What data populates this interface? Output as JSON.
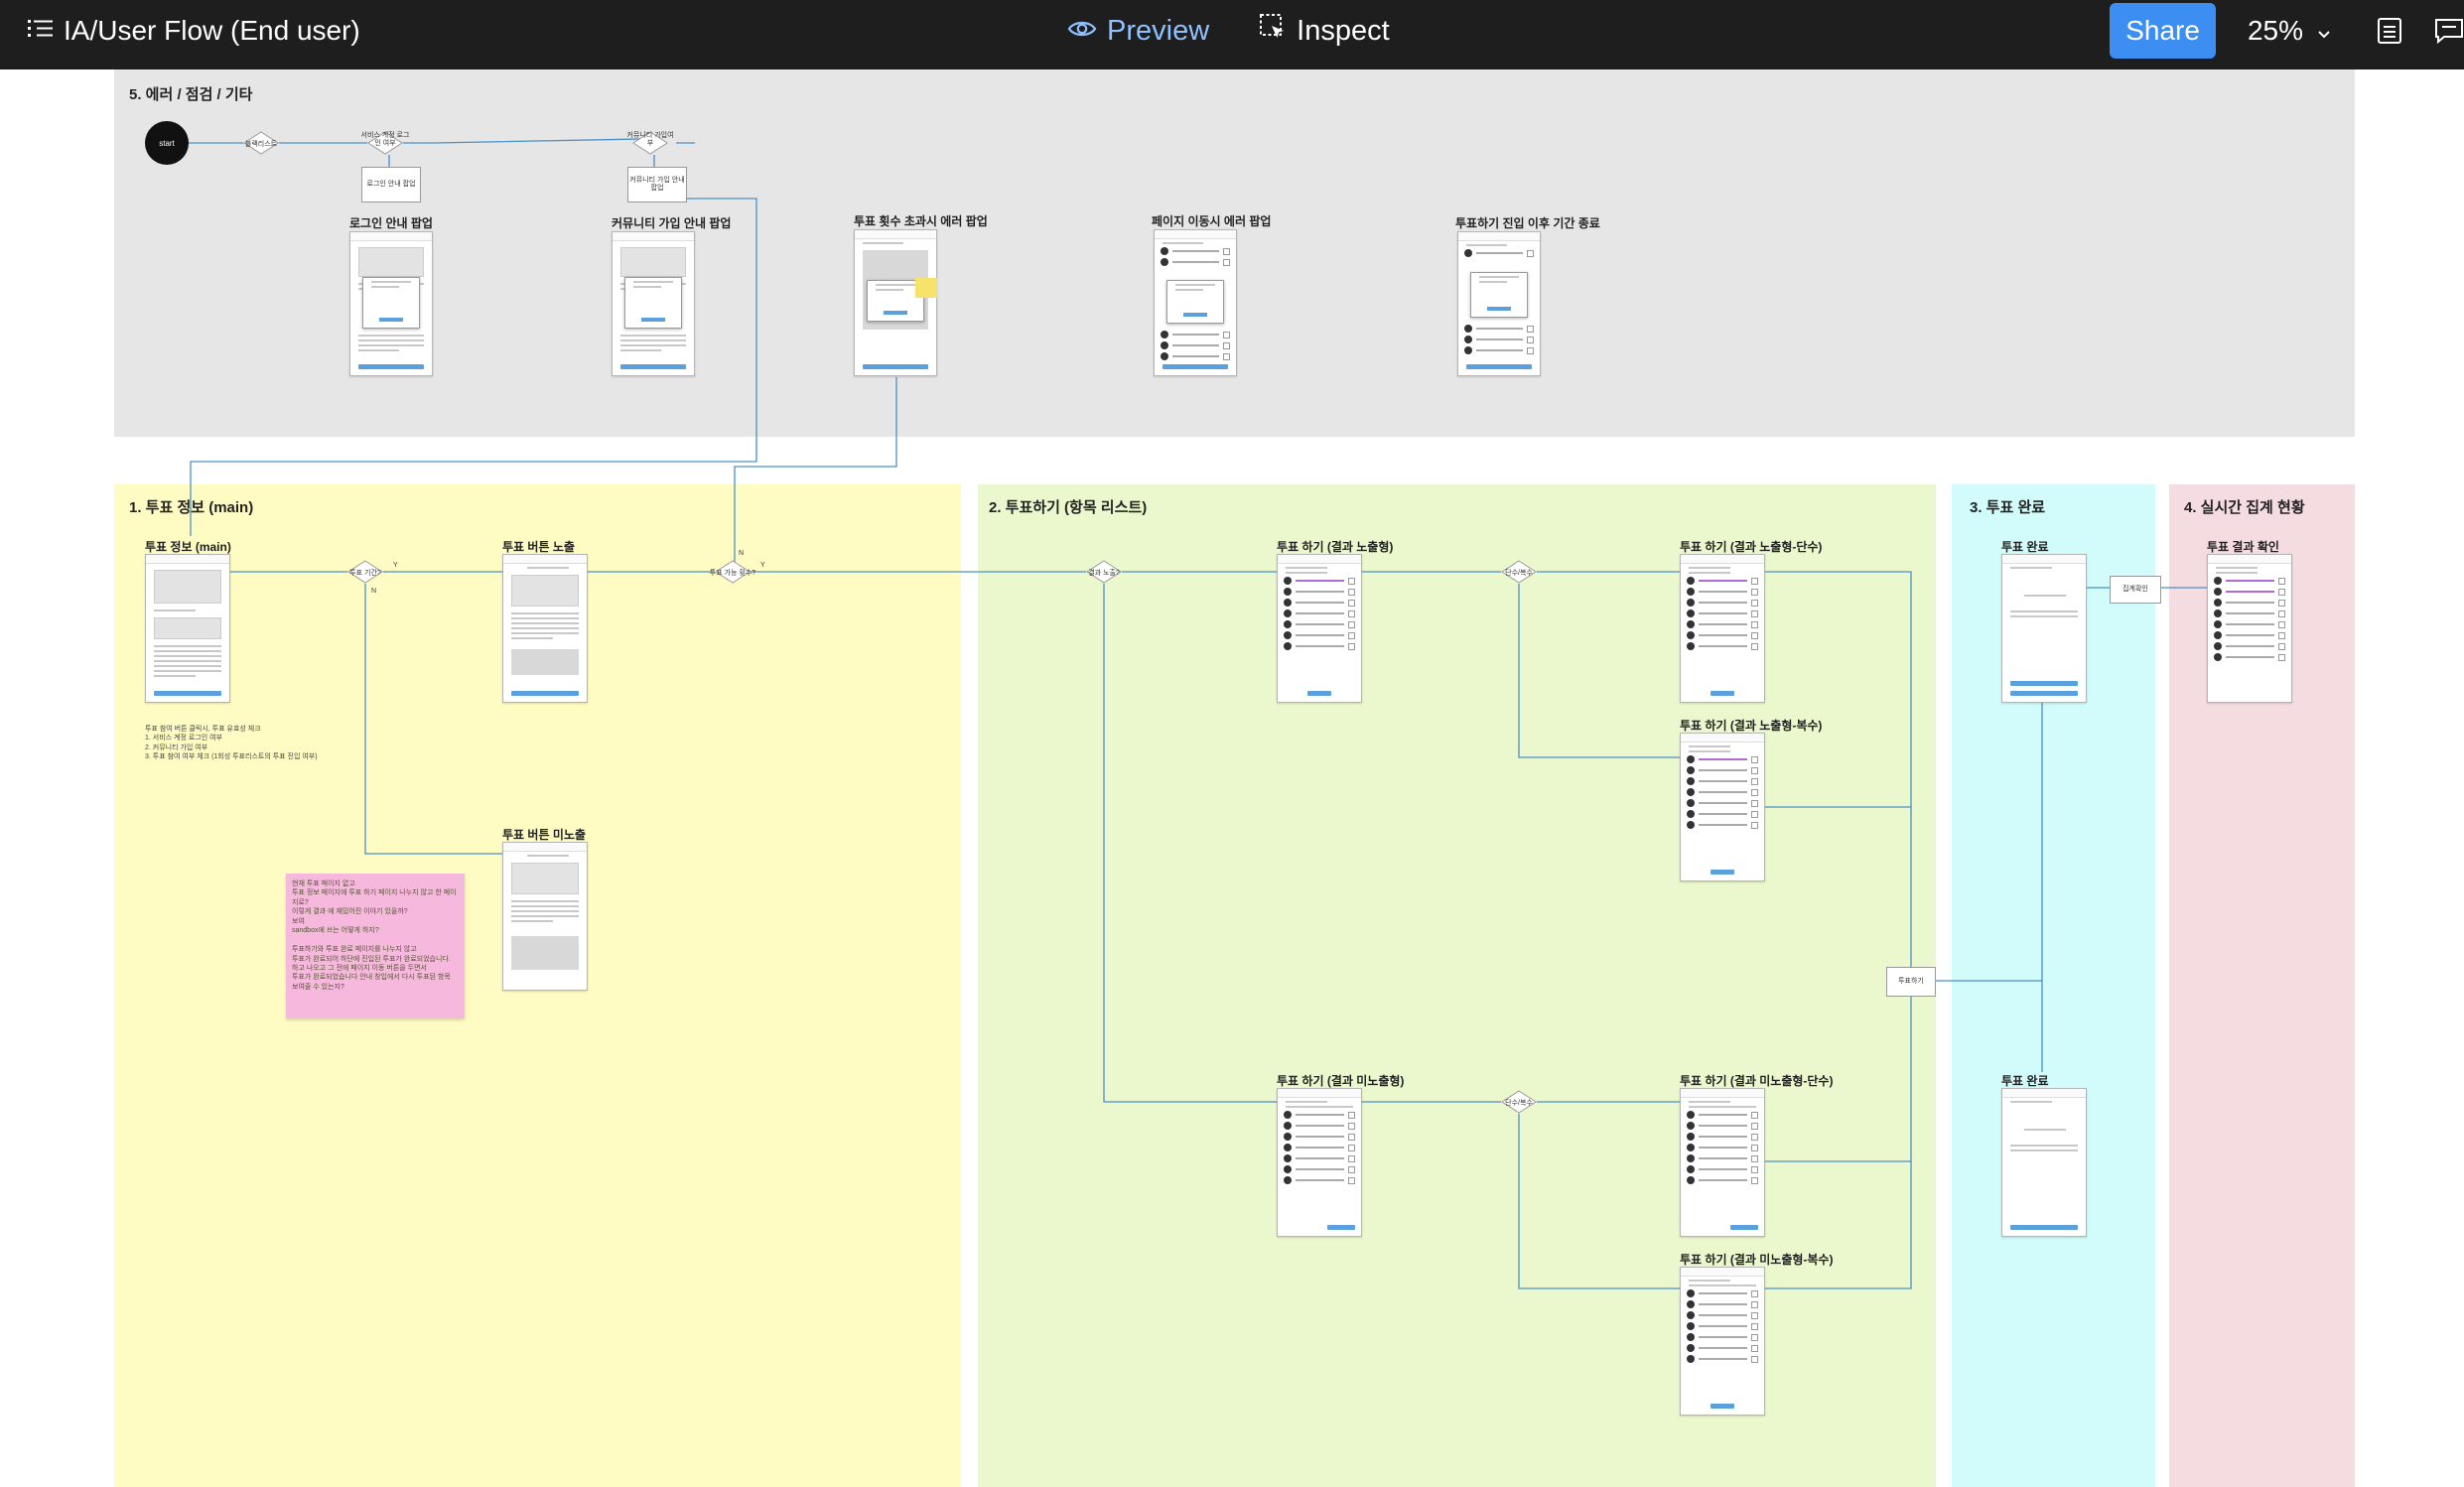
{
  "topbar": {
    "title": "IA/User Flow (End user)",
    "preview_label": "Preview",
    "inspect_label": "Inspect",
    "share_label": "Share",
    "zoom": "25%"
  },
  "colors": {
    "topbar_bg": "#1e1e1e",
    "share_bg": "#3c8ef3",
    "preview_text": "#8fc1ff",
    "section_error": "#e6e6e6",
    "section_info": "#fffcc3",
    "section_vote": "#ebf8cd",
    "section_done": "#d2fbfb",
    "section_result": "#f5dce1",
    "connector": "#4a90c8"
  },
  "sections": {
    "error": {
      "title": "5. 에러 / 점검 / 기타",
      "start_label": "start",
      "frames": [
        {
          "title": "로그인 안내 팝업"
        },
        {
          "title": "커뮤니티 가입 안내 팝업"
        },
        {
          "title": "투표 횟수 초과시 에러 팝업"
        },
        {
          "title": "페이지 이동시 에러 팝업"
        },
        {
          "title": "투표하기 진입 이후 기간 종료"
        }
      ]
    },
    "info": {
      "title": "1. 투표 정보 (main)",
      "frames": [
        {
          "title": "투표 정보 (main)"
        },
        {
          "title": "투표 버튼 노출"
        },
        {
          "title": "투표 버튼 미노출"
        }
      ],
      "note": "투표 참여 버튼 클릭시, 투표 유효성 체크\n1. 서비스 계정 로그인 여부\n2. 커뮤니티 가입 여부\n3. 투표 참여 여부 체크 (1회성 투표리스트의 투표 진입 여부)",
      "sticky": "현재 투표 페이지 없고\n투표 정보 페이지에 투표 하기 페이지 나누지 않고 한 페이지로?\n이렇게 결과 에 재밌어진 이야기 있을까?\n보여\nsandbox에 쓰는 어떻게 하지?\n\n투표하기와 투표 완료 페이지를 나누지 않고\n투표가 완료되어 하단에 진입된 투표가 완료되었습니다. 하고 나오고 그 전에 페이지 이동 버튼을 두면서\n투표가 완료되었습니다 안내 창입에서 다시 투표된 항목 보여줄 수 있는지?"
    },
    "vote": {
      "title": "2. 투표하기 (항목 리스트)",
      "frames": [
        {
          "title": "투표 하기 (결과 노출형)"
        },
        {
          "title": "투표 하기 (결과 노출형-단수)"
        },
        {
          "title": "투표 하기 (결과 노출형-복수)"
        },
        {
          "title": "투표 하기 (결과 미노출형)"
        },
        {
          "title": "투표 하기 (결과 미노출형-단수)"
        },
        {
          "title": "투표 하기 (결과 미노출형-복수)"
        }
      ],
      "submit_label": "투표하기"
    },
    "done": {
      "title": "3. 투표 완료",
      "frames": [
        {
          "title": "투표 완료"
        },
        {
          "title": "투표 완료"
        }
      ],
      "result_link": "집계확인"
    },
    "result": {
      "title": "4. 실시간 집계 현황",
      "frames": [
        {
          "title": "투표 결과 확인"
        }
      ]
    }
  },
  "flow": {
    "diamonds": [
      "블랙리스트",
      "서비스 계정 로그인 여부",
      "커뮤니티 가입여부",
      "투표 기간?",
      "투표 가능 횟수?",
      "결과 노출?",
      "단수/복수",
      "단수/복수"
    ],
    "boxes": [
      "로그인 안내 팝업",
      "커뮤니티 가입 안내 팝업"
    ],
    "branch_yes": "Y",
    "branch_no": "N"
  }
}
